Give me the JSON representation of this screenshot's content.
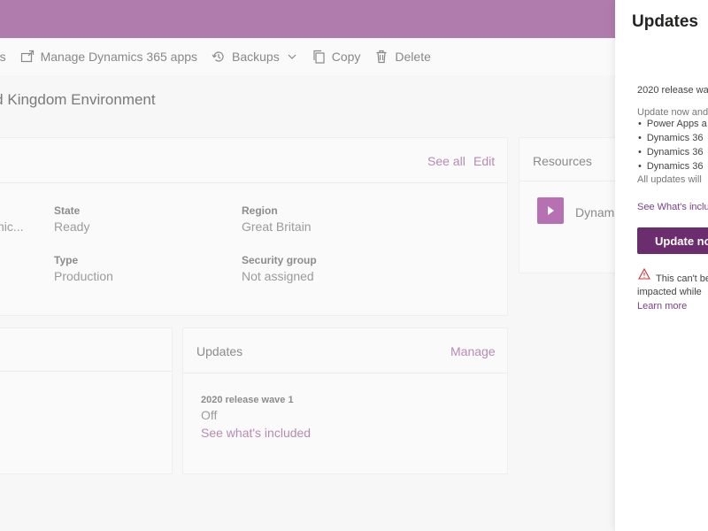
{
  "colors": {
    "accent": "#b07cad",
    "button": "#6c2d6e",
    "link": "#b78ab4",
    "warning": "#d13438"
  },
  "commandbar": {
    "settings_label": "ngs",
    "manage_label": "Manage Dynamics 365 apps",
    "backups_label": "Backups",
    "copy_label": "Copy",
    "delete_label": "Delete"
  },
  "page": {
    "title": "ted Kingdom Environment"
  },
  "details_card": {
    "see_all": "See all",
    "edit": "Edit",
    "truncated_value": "nic...",
    "state_label": "State",
    "state_value": "Ready",
    "region_label": "Region",
    "region_value": "Great Britain",
    "type_label": "Type",
    "type_value": "Production",
    "security_label": "Security group",
    "security_value": "Not assigned"
  },
  "resources_card": {
    "title": "Resources",
    "item_label": "Dynami"
  },
  "updates_card": {
    "title": "Updates",
    "manage": "Manage",
    "wave_label": "2020 release wave 1",
    "wave_state": "Off",
    "see_included": "See what's included"
  },
  "updates_panel": {
    "title": "Updates",
    "wave_heading": "2020 release wa",
    "intro": "Update now and",
    "items": [
      "Power Apps a",
      "Dynamics 36",
      "Dynamics 36",
      "Dynamics 36"
    ],
    "note": "All updates will",
    "see_included": "See What's inclu",
    "update_button": "Update no",
    "warning_line1": "This can't be",
    "warning_line2": "impacted while",
    "learn_more": "Learn more"
  }
}
